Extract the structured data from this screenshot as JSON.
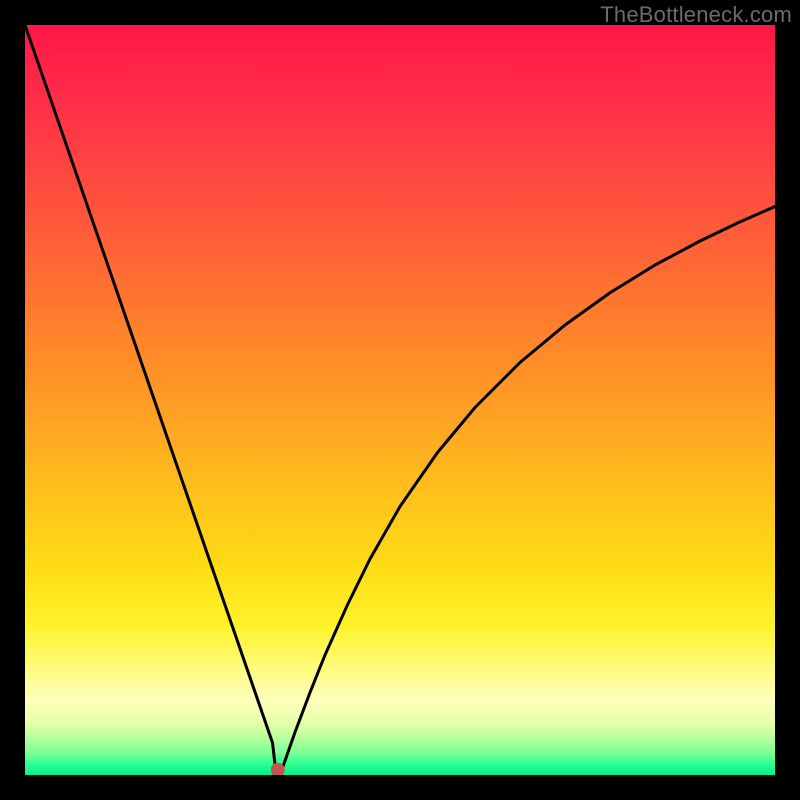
{
  "watermark": "TheBottleneck.com",
  "chart_data": {
    "type": "line",
    "title": "",
    "xlabel": "",
    "ylabel": "",
    "xlim": [
      0,
      100
    ],
    "ylim": [
      0,
      100
    ],
    "grid": false,
    "series": [
      {
        "name": "bottleneck-curve",
        "x": [
          0,
          5,
          10,
          15,
          20,
          25,
          28,
          30,
          31,
          32,
          33,
          33.5,
          34,
          36,
          38,
          40,
          43,
          46,
          50,
          55,
          60,
          66,
          72,
          78,
          84,
          90,
          95,
          100
        ],
        "y": [
          100,
          85.5,
          71,
          56.5,
          42,
          27.5,
          18.8,
          13,
          10.1,
          7.2,
          4.3,
          0,
          0,
          5.7,
          11,
          16,
          22.7,
          28.8,
          35.8,
          43,
          49,
          55,
          60,
          64.3,
          68,
          71.2,
          73.6,
          75.8
        ]
      }
    ],
    "marker": {
      "x": 33.7,
      "y": 0.7,
      "color": "#c4564c",
      "radius_px": 7
    },
    "colors": {
      "background_top": "#ff1745",
      "background_mid": "#ffd516",
      "background_bottom": "#00f08c",
      "frame": "#000000",
      "line": "#000000"
    }
  }
}
